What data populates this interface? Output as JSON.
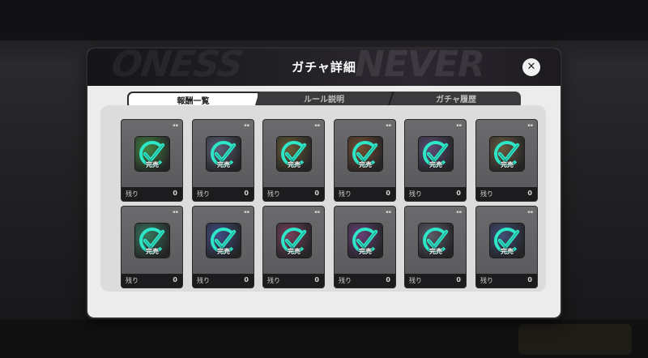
{
  "modal": {
    "title": "ガチャ詳細",
    "close_icon": "close-icon"
  },
  "tabs": [
    {
      "label": "報酬一覧",
      "active": true
    },
    {
      "label": "ルール説明",
      "active": false
    },
    {
      "label": "ガチャ履歴",
      "active": false
    }
  ],
  "cards": [
    {
      "status": "完売",
      "remaining_label": "残り",
      "remaining": "0",
      "art_color": "#3e8a3a"
    },
    {
      "status": "完売",
      "remaining_label": "残り",
      "remaining": "0",
      "art_color": "#5a5f7a"
    },
    {
      "status": "完売",
      "remaining_label": "残り",
      "remaining": "0",
      "art_color": "#6b5a2c"
    },
    {
      "status": "完売",
      "remaining_label": "残り",
      "remaining": "0",
      "art_color": "#7a4a2a"
    },
    {
      "status": "完売",
      "remaining_label": "残り",
      "remaining": "0",
      "art_color": "#5b4a7a"
    },
    {
      "status": "完売",
      "remaining_label": "残り",
      "remaining": "0",
      "art_color": "#6a5a3a"
    },
    {
      "status": "完売",
      "remaining_label": "残り",
      "remaining": "0",
      "art_color": "#2f7a5a"
    },
    {
      "status": "完売",
      "remaining_label": "残り",
      "remaining": "0",
      "art_color": "#3a4a8a"
    },
    {
      "status": "完売",
      "remaining_label": "残り",
      "remaining": "0",
      "art_color": "#7a3a5a"
    },
    {
      "status": "完売",
      "remaining_label": "残り",
      "remaining": "0",
      "art_color": "#6a3a7a"
    },
    {
      "status": "完売",
      "remaining_label": "残り",
      "remaining": "0",
      "art_color": "#5a5a6a"
    },
    {
      "status": "完売",
      "remaining_label": "残り",
      "remaining": "0",
      "art_color": "#3a4a7a"
    }
  ],
  "colors": {
    "accent_teal": "#2ee6c8",
    "header_dark": "#1c1a1f",
    "modal_bg": "#ececec"
  }
}
